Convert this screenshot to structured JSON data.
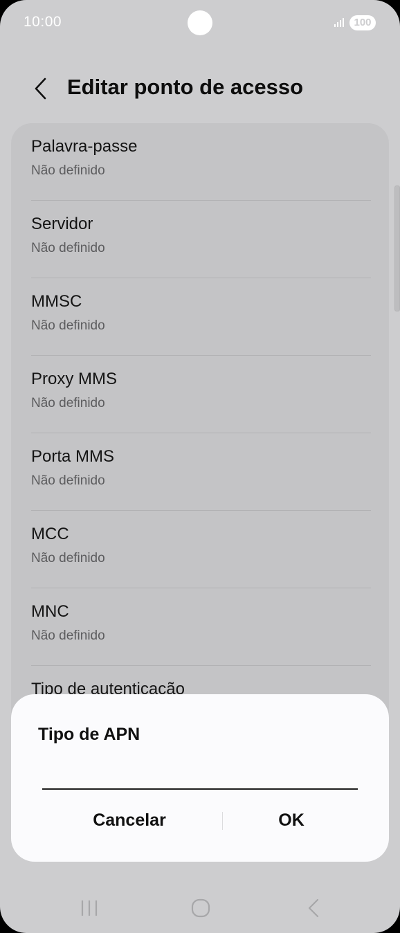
{
  "status_bar": {
    "time": "10:00",
    "battery": "100"
  },
  "header": {
    "title": "Editar ponto de acesso"
  },
  "settings": [
    {
      "title": "Palavra-passe",
      "value": "Não definido"
    },
    {
      "title": "Servidor",
      "value": "Não definido"
    },
    {
      "title": "MMSC",
      "value": "Não definido"
    },
    {
      "title": "Proxy MMS",
      "value": "Não definido"
    },
    {
      "title": "Porta MMS",
      "value": "Não definido"
    },
    {
      "title": "MCC",
      "value": "Não definido"
    },
    {
      "title": "MNC",
      "value": "Não definido"
    },
    {
      "title": "Tipo de autenticação",
      "value": ""
    }
  ],
  "dialog": {
    "title": "Tipo de APN",
    "input_value": "",
    "cancel_label": "Cancelar",
    "ok_label": "OK"
  },
  "icons": {
    "back": "chevron-left-icon",
    "signal": "signal-icon",
    "recents": "recents-icon",
    "home": "home-icon",
    "nav_back": "nav-back-icon"
  },
  "colors": {
    "background": "#cdcdcf",
    "card": "#c4c4c6",
    "dialog": "#fbfbfd",
    "text_primary": "#141414",
    "text_secondary": "#5c5c5e"
  }
}
